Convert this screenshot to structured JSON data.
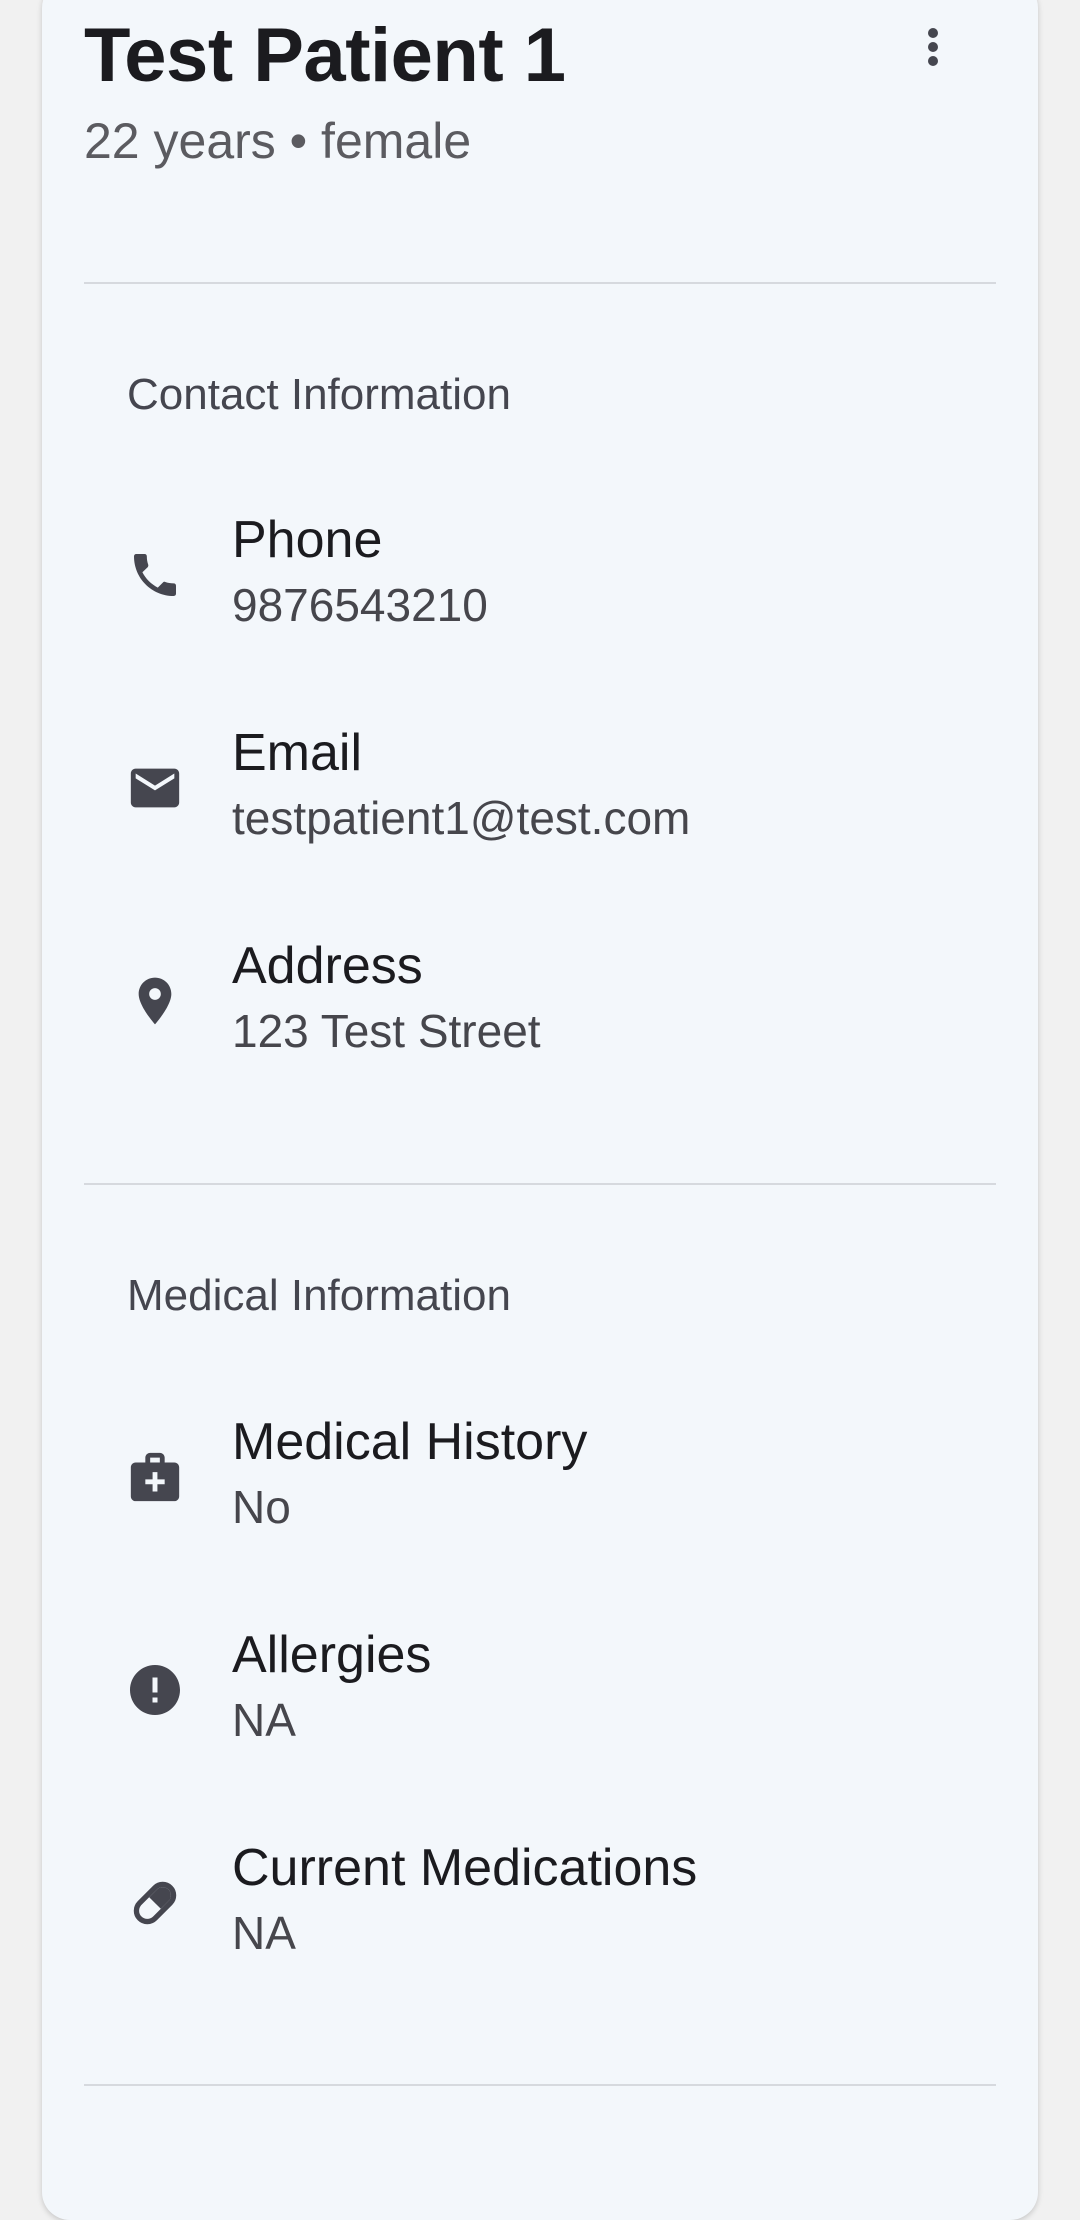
{
  "patient": {
    "name": "Test Patient 1",
    "summary": "22 years • female"
  },
  "menu": {
    "icon": "more-vert-icon"
  },
  "contact": {
    "title": "Contact Information",
    "items": [
      {
        "label": "Phone",
        "value": "9876543210",
        "icon": "phone-icon"
      },
      {
        "label": "Email",
        "value": "testpatient1@test.com",
        "icon": "email-icon"
      },
      {
        "label": "Address",
        "value": "123 Test Street",
        "icon": "location-pin-icon"
      }
    ]
  },
  "medical": {
    "title": "Medical Information",
    "items": [
      {
        "label": "Medical History",
        "value": "No",
        "icon": "medical-bag-icon"
      },
      {
        "label": "Allergies",
        "value": "NA",
        "icon": "alert-circle-icon"
      },
      {
        "label": "Current Medications",
        "value": "NA",
        "icon": "pill-icon"
      }
    ]
  },
  "colors": {
    "card_background": "#f3f7fb",
    "page_background": "#f1f1f1",
    "icon": "#45464f",
    "divider": "#d6d9de"
  }
}
